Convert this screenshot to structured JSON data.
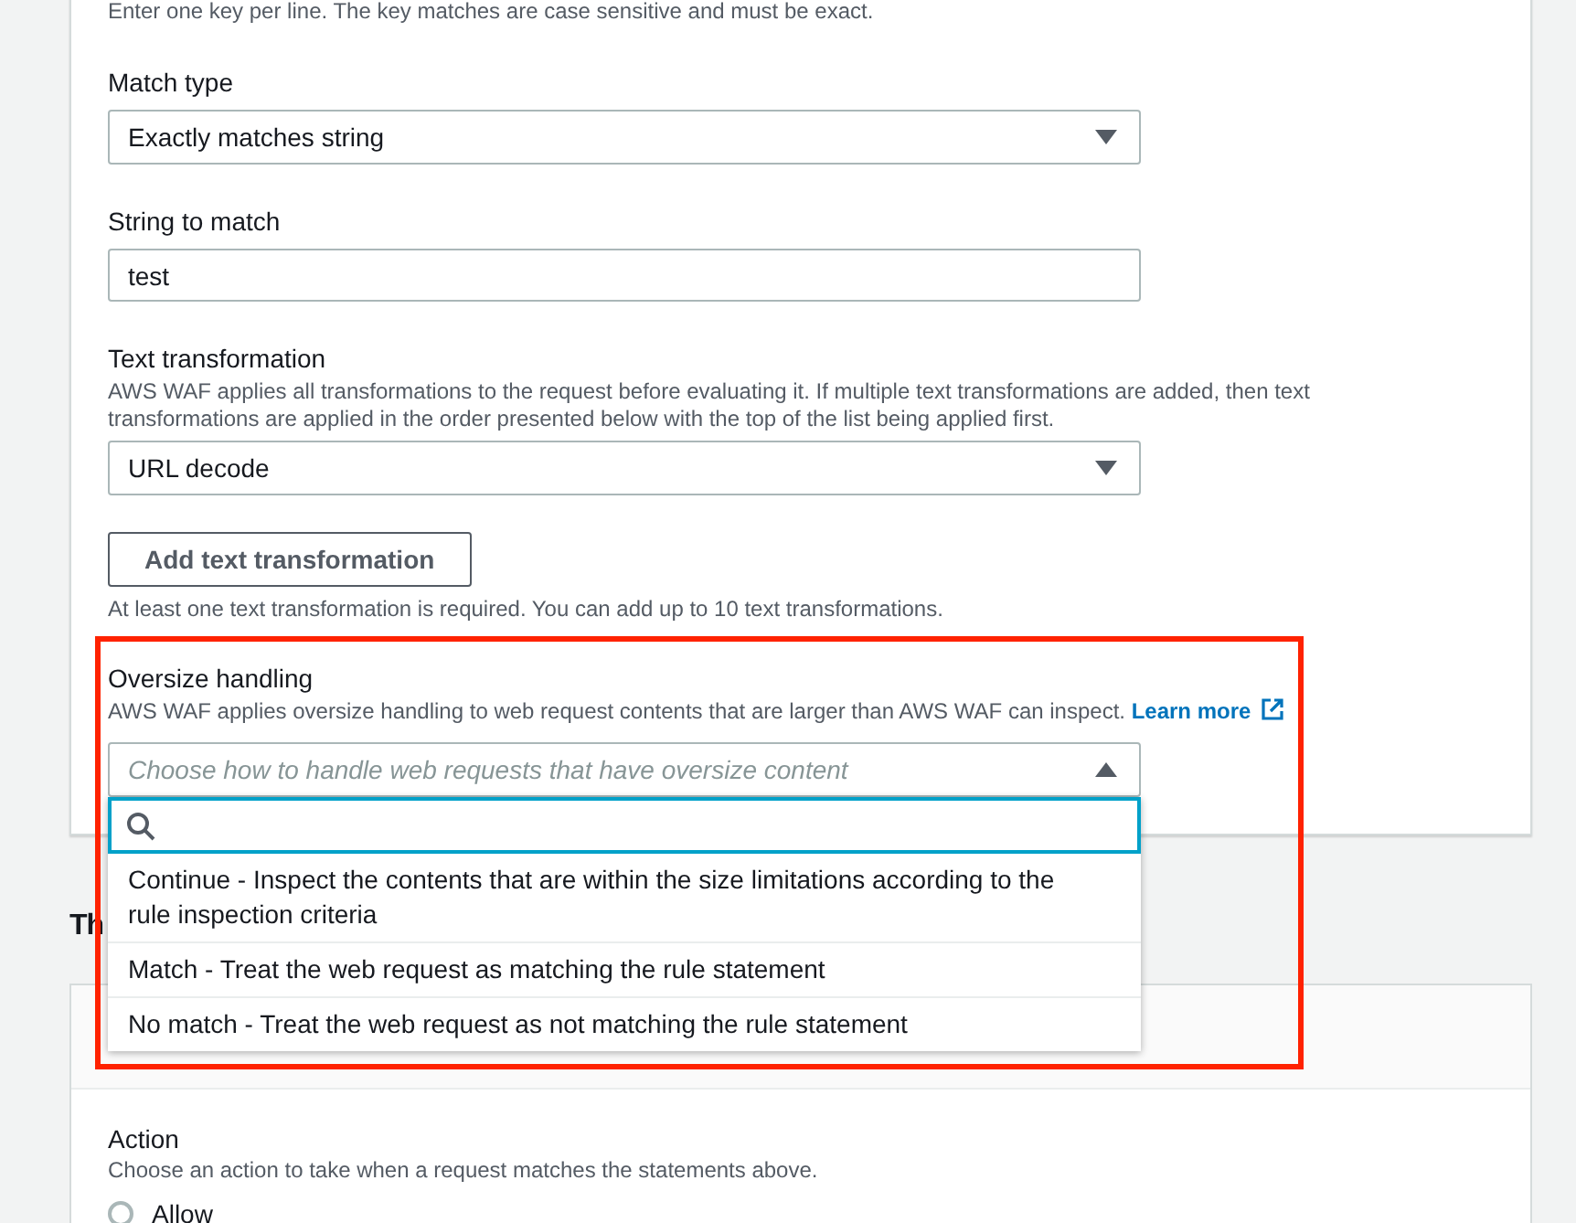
{
  "form": {
    "key_hint": "Enter one key per line. The key matches are case sensitive and must be exact.",
    "fields": [
      {
        "kind": "select",
        "label": "Match type",
        "value": "Exactly matches string"
      },
      {
        "kind": "input",
        "label": "String to match",
        "value": "test"
      },
      {
        "kind": "select",
        "label": "Text transformation",
        "description": "AWS WAF applies all transformations to the request before evaluating it. If multiple text transformations are added, then text transformations are applied in the order presented below with the top of the list being applied first.",
        "value": "URL decode"
      }
    ],
    "add_button": "Add text transformation",
    "add_hint": "At least one text transformation is required. You can add up to 10 text transformations.",
    "oversize": {
      "label": "Oversize handling",
      "description": "AWS WAF applies oversize handling to web request contents that are larger than AWS WAF can inspect.",
      "link": "Learn more",
      "placeholder": "Choose how to handle web requests that have oversize content",
      "expanded": true,
      "options": [
        {
          "label": "Continue - Inspect the contents that are within the size limitations according to the rule inspection criteria",
          "selected": false
        },
        {
          "label": "Match - Treat the web request as matching the rule statement",
          "selected": false
        },
        {
          "label": "No match - Treat the web request as not matching the rule statement",
          "selected": false
        }
      ]
    }
  },
  "section_heading": "Th",
  "action": {
    "label": "Action",
    "description": "Choose an action to take when a request matches the statements above.",
    "options": [
      {
        "label": "Allow",
        "selected": false
      }
    ]
  }
}
